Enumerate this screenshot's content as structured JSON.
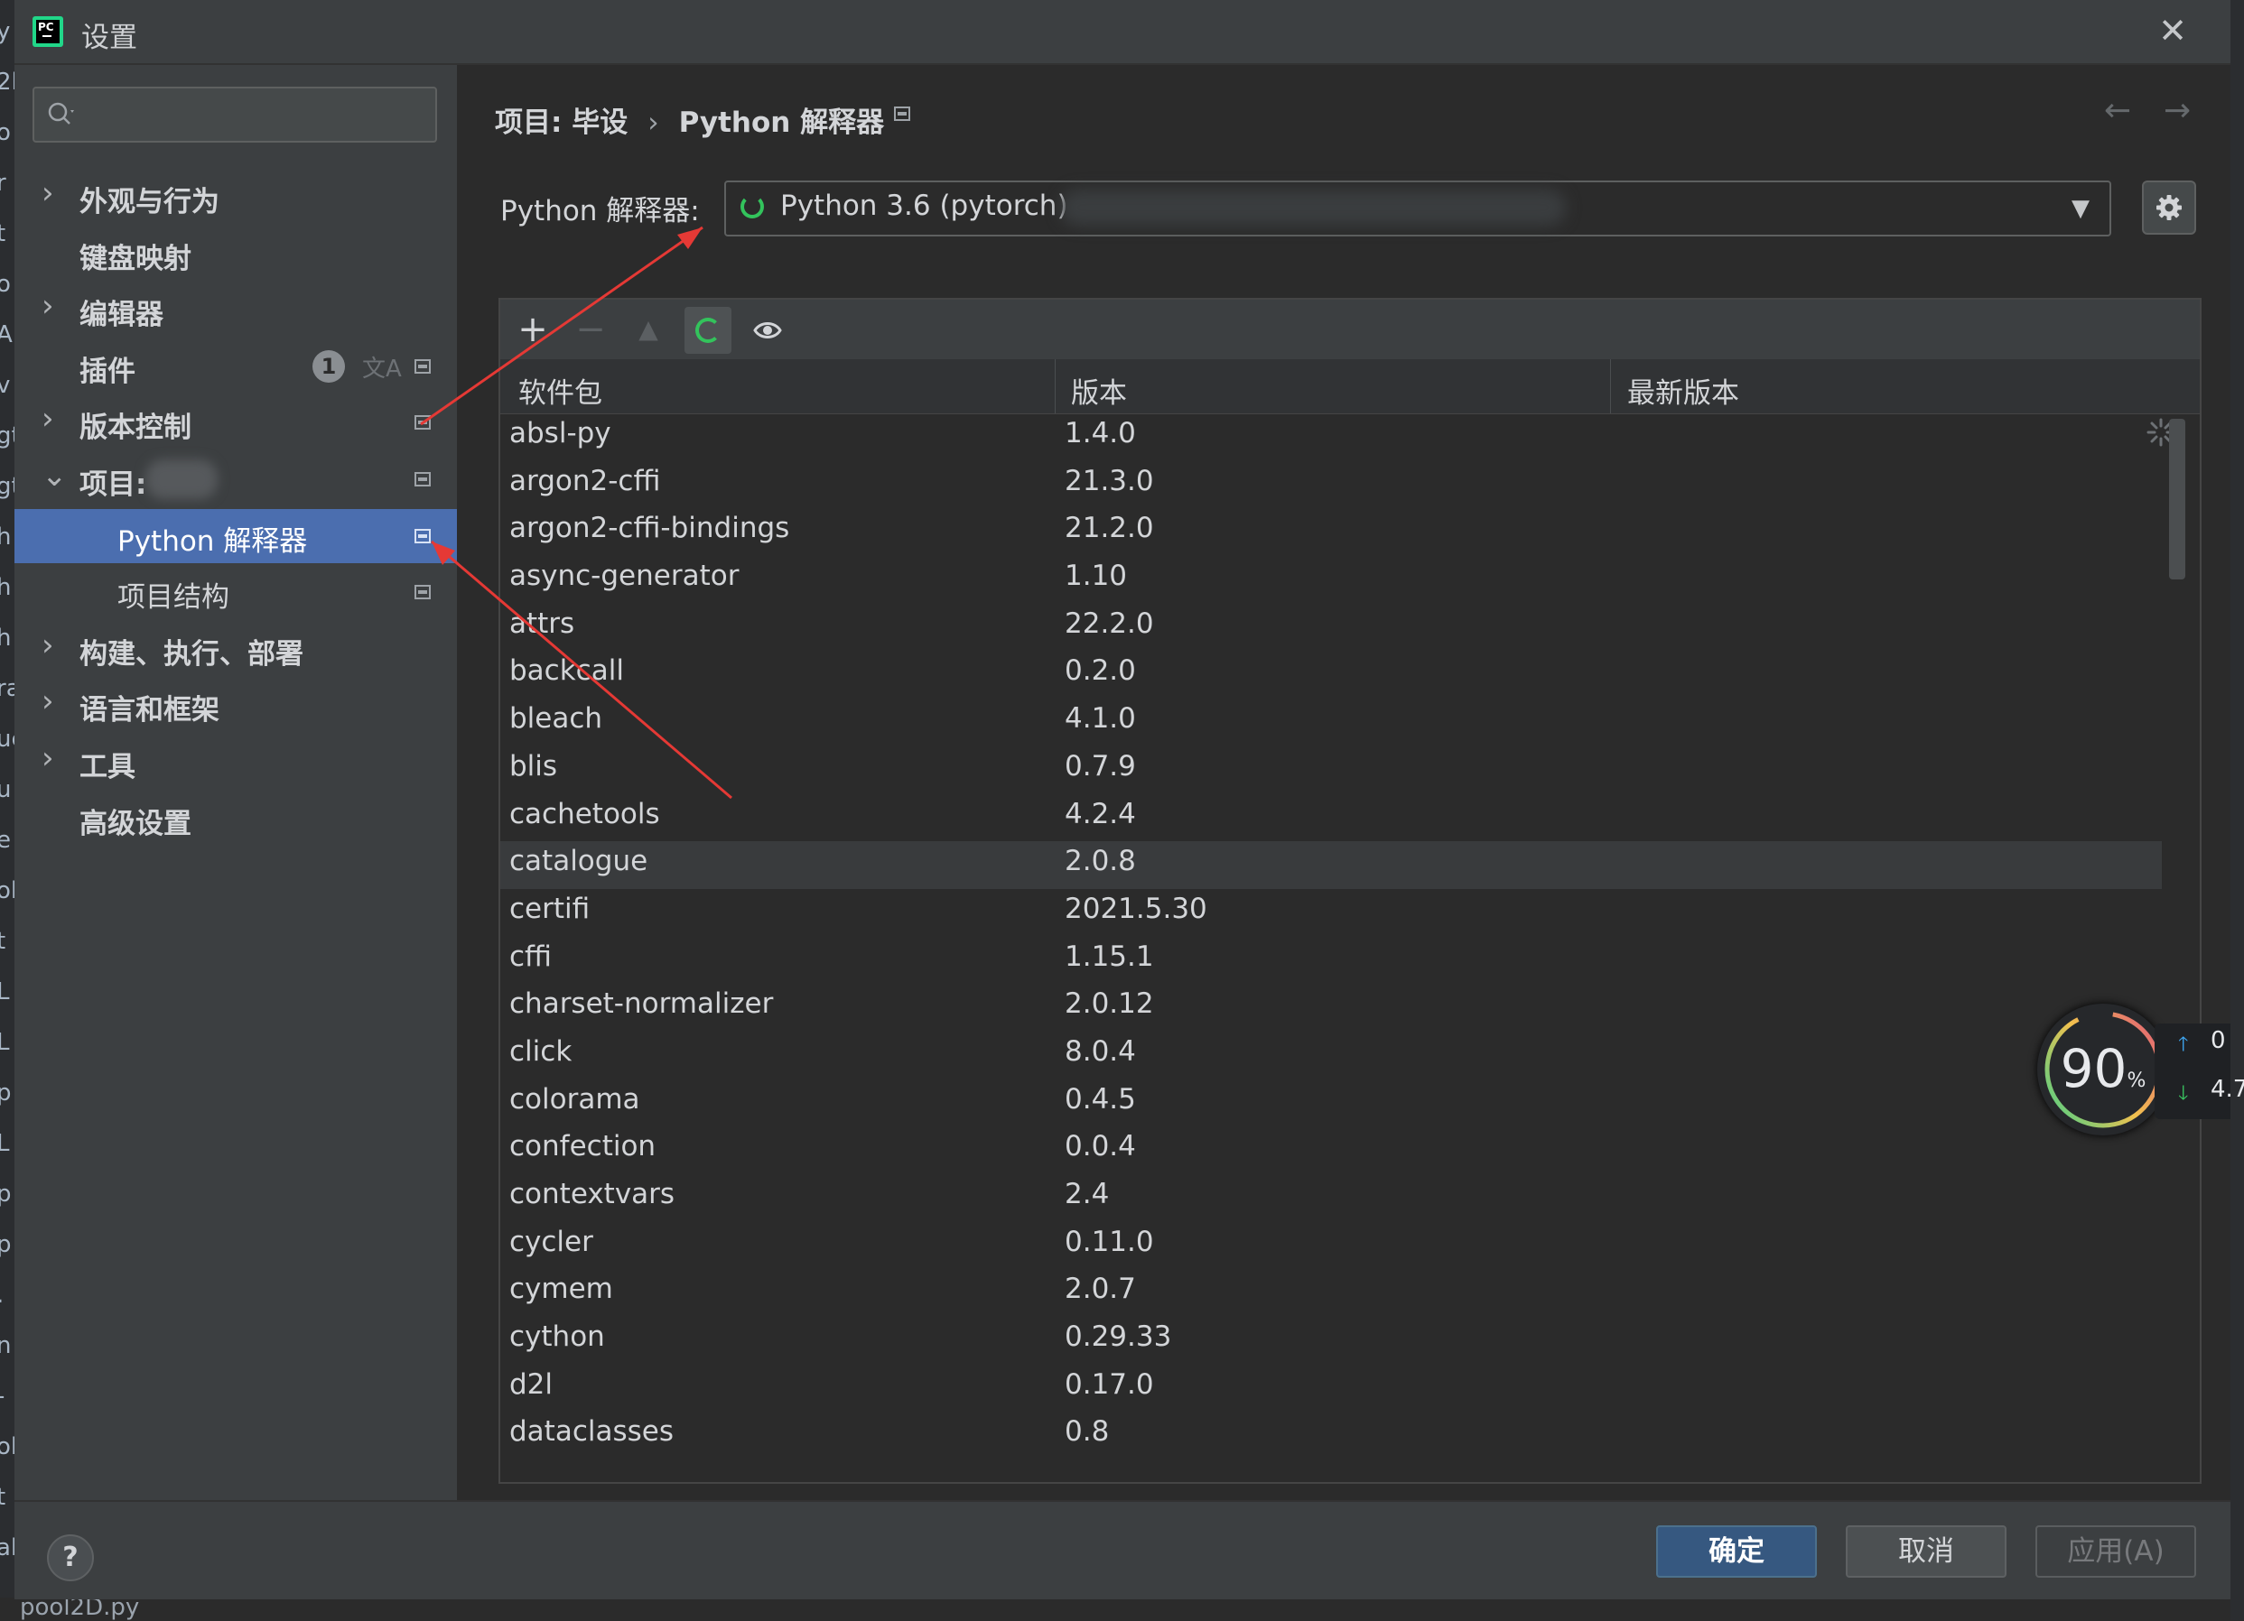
{
  "window": {
    "title": "设置",
    "close_glyph": "✕"
  },
  "background": {
    "left_edge_chars": [
      "y",
      "2l",
      "o",
      "r",
      "t",
      "o",
      "A",
      "v",
      "gt",
      "gt",
      "h",
      "h",
      "h",
      "ra",
      "uc",
      "u",
      "e",
      "ol",
      "t",
      "L",
      "L",
      "p",
      "L",
      "p",
      "p",
      ".",
      "n",
      "-",
      "ol.",
      "t",
      "al"
    ],
    "bottom_file": "pool2D.py"
  },
  "sidebar": {
    "search_placeholder": "",
    "items": [
      {
        "label": "外观与行为",
        "expandable": true,
        "expanded": false
      },
      {
        "label": "键盘映射",
        "expandable": false
      },
      {
        "label": "编辑器",
        "expandable": true,
        "expanded": false
      },
      {
        "label": "插件",
        "expandable": false,
        "badge": "1",
        "translate_icon": "文A"
      },
      {
        "label": "版本控制",
        "expandable": true,
        "expanded": false
      },
      {
        "label": "项目:",
        "expandable": true,
        "expanded": true
      },
      {
        "label": "Python 解释器",
        "child": true,
        "selected": true
      },
      {
        "label": "项目结构",
        "child": true
      },
      {
        "label": "构建、执行、部署",
        "expandable": true,
        "expanded": false
      },
      {
        "label": "语言和框架",
        "expandable": true,
        "expanded": false
      },
      {
        "label": "工具",
        "expandable": true,
        "expanded": false
      },
      {
        "label": "高级设置",
        "expandable": false
      }
    ]
  },
  "main": {
    "breadcrumb": {
      "project": "项目: 毕设",
      "separator": "›",
      "page": "Python 解释器"
    },
    "nav": {
      "back": "←",
      "forward": "→"
    },
    "interpreter": {
      "label": "Python 解释器:",
      "value": "Python 3.6 (pytorch)",
      "caret": "▼"
    },
    "toolbar": {
      "add": "+",
      "remove": "−",
      "upgrade": "▲"
    },
    "table": {
      "columns": [
        "软件包",
        "版本",
        "最新版本"
      ],
      "rows": [
        {
          "name": "absl-py",
          "version": "1.4.0"
        },
        {
          "name": "argon2-cffi",
          "version": "21.3.0"
        },
        {
          "name": "argon2-cffi-bindings",
          "version": "21.2.0"
        },
        {
          "name": "async-generator",
          "version": "1.10"
        },
        {
          "name": "attrs",
          "version": "22.2.0"
        },
        {
          "name": "backcall",
          "version": "0.2.0"
        },
        {
          "name": "bleach",
          "version": "4.1.0"
        },
        {
          "name": "blis",
          "version": "0.7.9"
        },
        {
          "name": "cachetools",
          "version": "4.2.4"
        },
        {
          "name": "catalogue",
          "version": "2.0.8",
          "highlight": true
        },
        {
          "name": "certifi",
          "version": "2021.5.30"
        },
        {
          "name": "cffi",
          "version": "1.15.1"
        },
        {
          "name": "charset-normalizer",
          "version": "2.0.12"
        },
        {
          "name": "click",
          "version": "8.0.4"
        },
        {
          "name": "colorama",
          "version": "0.4.5"
        },
        {
          "name": "confection",
          "version": "0.0.4"
        },
        {
          "name": "contextvars",
          "version": "2.4"
        },
        {
          "name": "cycler",
          "version": "0.11.0"
        },
        {
          "name": "cymem",
          "version": "2.0.7"
        },
        {
          "name": "cython",
          "version": "0.29.33"
        },
        {
          "name": "d2l",
          "version": "0.17.0"
        },
        {
          "name": "dataclasses",
          "version": "0.8"
        }
      ]
    }
  },
  "footer": {
    "help": "?",
    "ok": "确定",
    "cancel": "取消",
    "apply": "应用(A)"
  },
  "system_widget": {
    "percent": "90",
    "percent_unit": "%",
    "upload": "0",
    "download": "4.7"
  },
  "colors": {
    "accent_selected": "#4b6eaf",
    "ok_button": "#365880",
    "annotation_arrow": "#e53935",
    "loading_green": "#33c35c"
  }
}
